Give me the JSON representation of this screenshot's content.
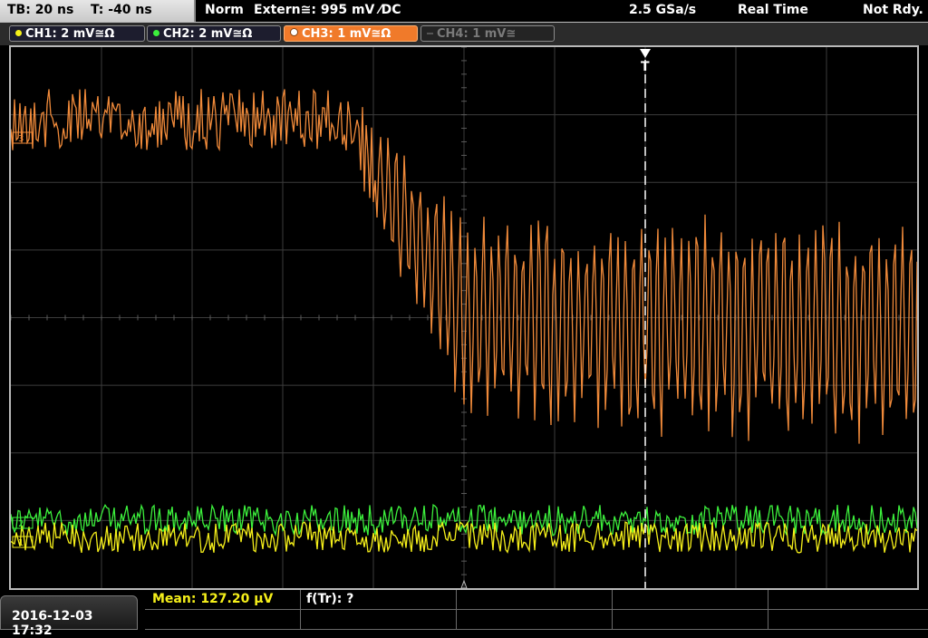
{
  "topbar": {
    "timebase": "TB: 20 ns",
    "trigger_time": "T: -40 ns",
    "trigger_mode": "Norm",
    "trigger_source": "Extern≅: 995 mV ⁄DC",
    "sample_rate": "2.5 GSa/s",
    "acq_mode": "Real Time",
    "status": "Not Rdy."
  },
  "channels": [
    {
      "label": "CH1: 2 mV≅Ω",
      "color": "#f5ef1a",
      "active": true
    },
    {
      "label": "CH2: 2 mV≅Ω",
      "color": "#3cf03c",
      "active": true
    },
    {
      "label": "CH3: 1 mV≅Ω",
      "color": "#f08a3a",
      "active": true,
      "selected": true
    },
    {
      "label": "CH4: 1 mV≅",
      "color": "#8a8a8a",
      "active": false
    }
  ],
  "waveform_colors": {
    "ch1": "#f5ef1a",
    "ch2": "#3cf03c",
    "ch3": "#f08a3a"
  },
  "markers": {
    "trigger_label": "T",
    "ch3_marker": "3",
    "ch2_marker": "2",
    "ch1_marker": "1"
  },
  "bottom": {
    "datetime": "2016-12-03 17:32",
    "mean_label": "Mean: 127.20 µV",
    "mean_color": "#f5ef1a",
    "func_label": "f(Tr): ?"
  }
}
